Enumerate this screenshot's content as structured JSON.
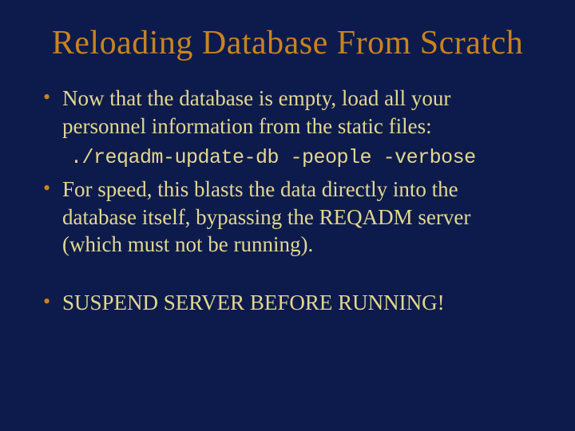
{
  "title": "Reloading Database From Scratch",
  "bullets": {
    "b1": "Now that the database is empty, load all your personnel information from the static files:",
    "code": "./reqadm-update-db -people -verbose",
    "b2": "For speed, this blasts the data directly into the database itself, bypassing the REQADM server (which must not be running).",
    "b3": "SUSPEND SERVER BEFORE RUNNING!"
  }
}
